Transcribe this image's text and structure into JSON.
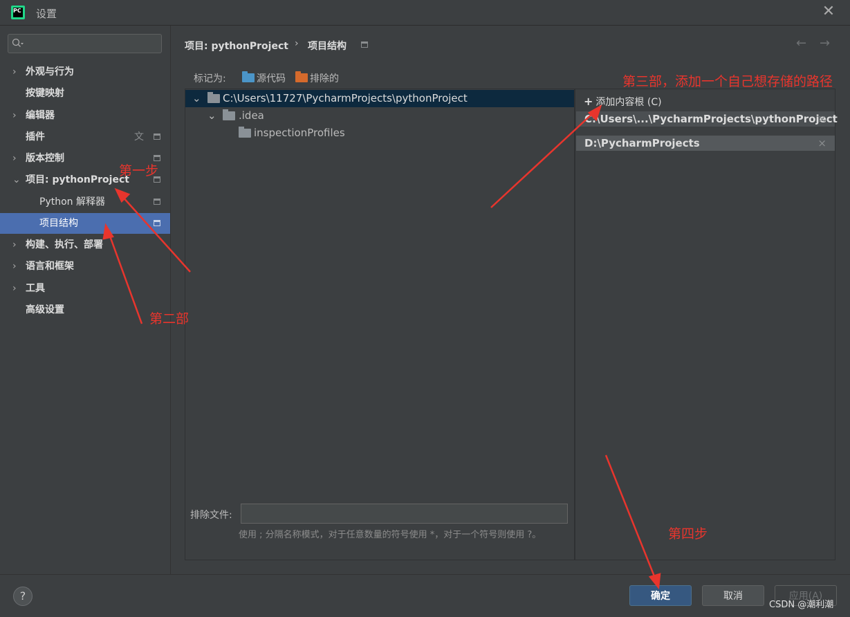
{
  "window": {
    "title": "设置",
    "logo_text": "PC",
    "close_glyph": "✕"
  },
  "search": {
    "placeholder": ""
  },
  "sidebar": {
    "items": [
      {
        "label": "外观与行为",
        "expandable": true
      },
      {
        "label": "按键映射",
        "expandable": false
      },
      {
        "label": "编辑器",
        "expandable": true
      },
      {
        "label": "插件",
        "expandable": false
      },
      {
        "label": "版本控制",
        "expandable": true
      },
      {
        "label": "项目: pythonProject",
        "expandable": true,
        "expanded": true
      },
      {
        "label": "Python 解释器",
        "child": true
      },
      {
        "label": "项目结构",
        "child": true,
        "selected": true
      },
      {
        "label": "构建、执行、部署",
        "expandable": true
      },
      {
        "label": "语言和框架",
        "expandable": true
      },
      {
        "label": "工具",
        "expandable": true
      },
      {
        "label": "高级设置",
        "expandable": false
      }
    ]
  },
  "breadcrumb": {
    "parent": "项目: pythonProject",
    "separator": "›",
    "current": "项目结构"
  },
  "mark_as": {
    "label": "标记为:",
    "sources": "源代码",
    "excluded": "排除的"
  },
  "tree": {
    "root": "C:\\Users\\11727\\PycharmProjects\\pythonProject",
    "children": [
      ".idea",
      "inspectionProfiles"
    ]
  },
  "content_roots": {
    "add_label": "添加内容根 (C)",
    "entries": [
      "C:\\Users\\...\\PycharmProjects\\pythonProject",
      "D:\\PycharmProjects"
    ]
  },
  "exclude": {
    "label": "排除文件:",
    "value": "",
    "hint": "使用 ; 分隔名称模式，对于任意数量的符号使用 *，对于一个符号则使用 ?。"
  },
  "buttons": {
    "help": "?",
    "ok": "确定",
    "cancel": "取消",
    "apply": "应用(A)"
  },
  "annotations": {
    "step1": "第一步",
    "step2": "第二部",
    "step3": "第三部，添加一个自己想存储的路径",
    "step4": "第四步",
    "color": "#e8352d"
  },
  "watermark": "CSDN @潮利潮",
  "colors": {
    "selection": "#4b6eaf",
    "tree_selection": "#0d293e",
    "ok_button": "#365880"
  }
}
